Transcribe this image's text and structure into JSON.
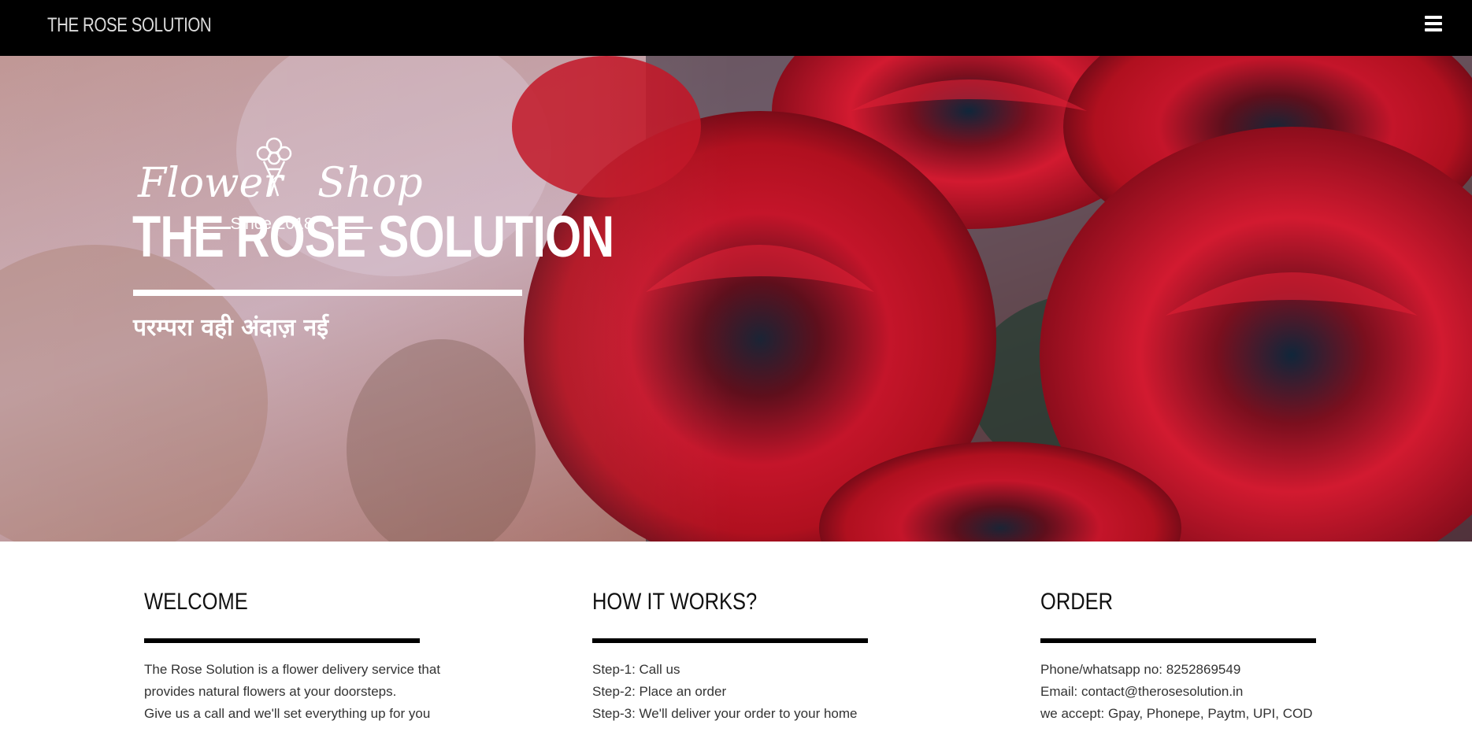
{
  "navbar": {
    "brand": "THE ROSE SOLUTION",
    "menu_icon": "hamburger-menu-icon",
    "background": "#000000"
  },
  "hero": {
    "logo": {
      "left_word": "Flower",
      "right_word": "Shop",
      "since": "Since 2018",
      "icon": "flower-bouquet-icon"
    },
    "title": "THE ROSE SOLUTION",
    "tagline": "परम्परा वही अंदाज़ नई",
    "image": "red-roses-background"
  },
  "sections": [
    {
      "heading": "WELCOME",
      "lines": [
        "The Rose Solution is a flower delivery service that",
        "provides natural flowers at your doorsteps.",
        "Give us a call and we'll set everything up for you"
      ]
    },
    {
      "heading": "HOW IT WORKS?",
      "lines": [
        "Step-1: Call us",
        "Step-2: Place an order",
        "Step-3: We'll deliver your order to your home"
      ]
    },
    {
      "heading": "ORDER",
      "lines": [
        "Phone/whatsapp no: 8252869549",
        "Email: contact@therosesolution.in",
        "we accept: Gpay, Phonepe, Paytm, UPI, COD"
      ]
    }
  ],
  "colors": {
    "accent": "#000000",
    "rose_red": "#c8102e",
    "text": "#333333"
  }
}
